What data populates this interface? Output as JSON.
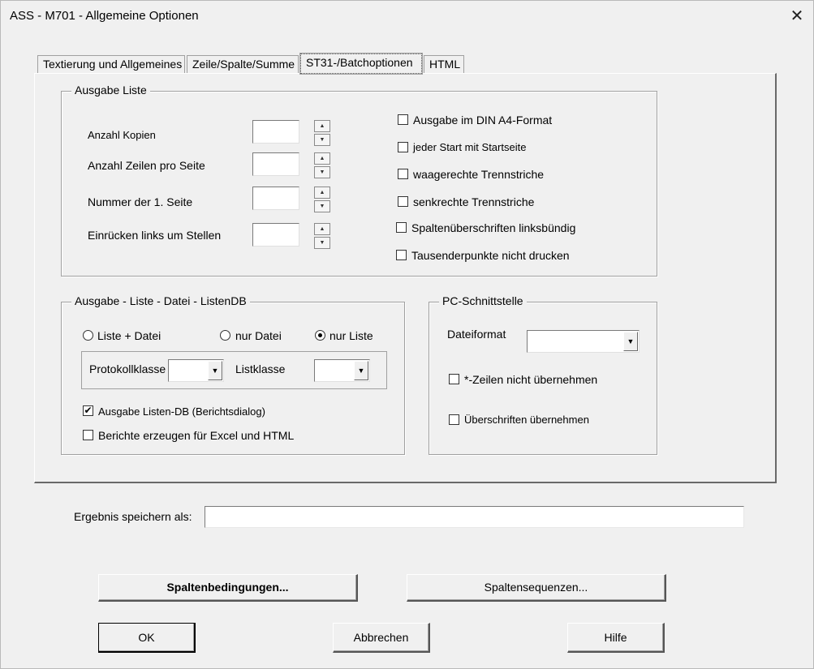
{
  "window": {
    "title": "ASS - M701 - Allgemeine Optionen",
    "close_glyph": "✕"
  },
  "tabs": [
    {
      "label": "Textierung und Allgemeines"
    },
    {
      "label": "Zeile/Spalte/Summe"
    },
    {
      "label": "ST31-/Batchoptionen"
    },
    {
      "label": "HTML"
    }
  ],
  "ausgabe_liste": {
    "title": "Ausgabe Liste",
    "fields": [
      {
        "label": "Anzahl Kopien",
        "value": ""
      },
      {
        "label": "Anzahl Zeilen pro Seite",
        "value": ""
      },
      {
        "label": "Nummer der 1. Seite",
        "value": ""
      },
      {
        "label": "Einrücken links um Stellen",
        "value": ""
      }
    ],
    "checkboxes": [
      {
        "label": "Ausgabe im DIN A4-Format",
        "checked": false
      },
      {
        "label": "jeder Start mit Startseite",
        "checked": false
      },
      {
        "label": "waagerechte Trennstriche",
        "checked": false
      },
      {
        "label": "senkrechte Trennstriche",
        "checked": false
      },
      {
        "label": "Spaltenüberschriften linksbündig",
        "checked": false
      },
      {
        "label": "Tausenderpunkte nicht drucken",
        "checked": false
      }
    ]
  },
  "ausgabe_datei": {
    "title": "Ausgabe - Liste - Datei - ListenDB",
    "radios": [
      {
        "label": "Liste + Datei",
        "checked": false
      },
      {
        "label": "nur Datei",
        "checked": false
      },
      {
        "label": "nur Liste",
        "checked": true
      }
    ],
    "protokollklasse_label": "Protokollklasse",
    "protokollklasse_value": "",
    "listklasse_label": "Listklasse",
    "listklasse_value": "",
    "checkboxes": [
      {
        "label": "Ausgabe Listen-DB (Berichtsdialog)",
        "checked": true
      },
      {
        "label": "Berichte erzeugen für Excel und HTML",
        "checked": false
      }
    ]
  },
  "pc_schnittstelle": {
    "title": "PC-Schnittstelle",
    "dateiformat_label": "Dateiformat",
    "dateiformat_value": "",
    "checkboxes": [
      {
        "label": "*-Zeilen nicht übernehmen",
        "checked": false
      },
      {
        "label": "Überschriften übernehmen",
        "checked": false
      }
    ]
  },
  "ergebnis": {
    "label": "Ergebnis speichern als:",
    "value": ""
  },
  "buttons": {
    "spaltenbedingungen": "Spaltenbedingungen...",
    "spaltensequenzen": "Spaltensequenzen...",
    "ok": "OK",
    "abbrechen": "Abbrechen",
    "hilfe": "Hilfe"
  },
  "icons": {
    "checkmark": "✔",
    "combo_arrow": "▼",
    "spin_up": "▲",
    "spin_down": "▼"
  }
}
